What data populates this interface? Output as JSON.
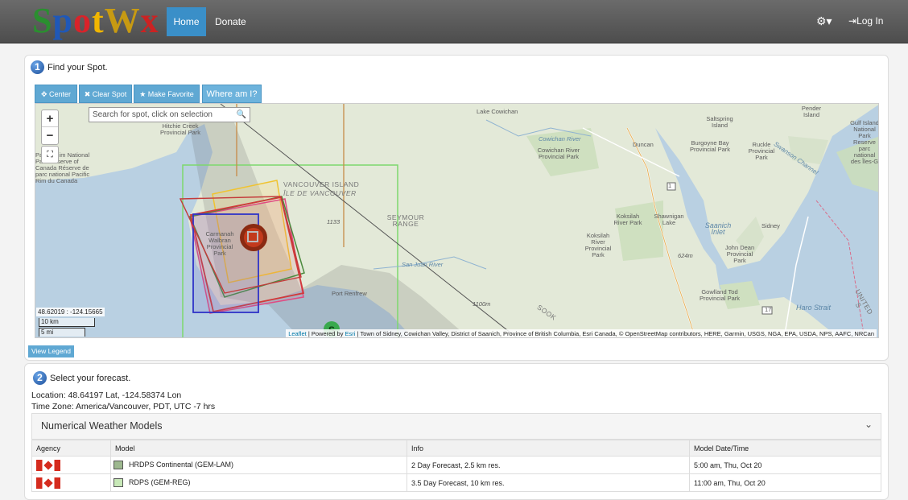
{
  "navbar": {
    "logo": [
      "S",
      "p",
      "o",
      "t",
      "W",
      "x"
    ],
    "home_label": "Home",
    "donate_label": "Donate",
    "settings_icon": "⚙▾",
    "login_label": "Log In"
  },
  "step1": {
    "number": "1",
    "title": "Find your Spot."
  },
  "toolbar": {
    "center_label": "✥ Center",
    "clear_label": "✖ Clear Spot",
    "favorite_label": "★ Make Favorite",
    "where_label": "Where am I?"
  },
  "map": {
    "search_placeholder": "Search for spot, click on selection",
    "zoom_in": "+",
    "zoom_out": "−",
    "coords": "48.62019 : -124.15665",
    "scale_km": "10 km",
    "scale_mi": "5 mi",
    "attribution_leaflet": "Leaflet",
    "attribution_text1": " | Powered by ",
    "attribution_esri": "Esri",
    "attribution_text2": " | Town of Sidney, Cowichan Valley, District of Saanich, Province of British Columbia, Esri Canada, © OpenStreetMap contributors, HERE, Garmin, USGS, NGA, EPA, USDA, NPS, AAFC, NRCan",
    "labels": {
      "pender": "Pender Island",
      "saltspring": "Saltspring Island",
      "gulf": "Gulf Island National Park Reserve parc national des Îles-G",
      "lake_cowichan": "Lake Cowichan",
      "duncan": "Duncan",
      "burgoyne": "Burgoyne Bay Provincial Park",
      "ruckle": "Ruckle Provincial Park",
      "hitchie": "Hitchie Creek Provincial Park",
      "pacific_rim": "Pacific Rim National Park Reserve of Canada Réserve de parc national Pacific Rim du Canada",
      "cowichan_river_park": "Cowichan River Provincial Park",
      "vancouver_island": "VANCOUVER ISLAND",
      "ile_vancouver": "ÎLE DE VANCOUVER",
      "seymour": "SEYMOUR RANGE",
      "carmanah": "Carmanah Walbran Provincial Park",
      "koksilah": "Koksilah River Park",
      "koksilah_park": "Koksilah River Provincial Park",
      "shawnigan": "Shawnigan Lake",
      "saanich": "Saanich Inlet",
      "sidney": "Sidney",
      "john_dean": "John Dean Provincial Park",
      "gowlland": "Gowlland Tod Provincial Park",
      "haro": "Haro Strait",
      "port_renfrew": "Port Renfrew",
      "san_juan": "San Juan River",
      "cowichan_river": "Cowichan River",
      "elev_624": "624m",
      "elev_1100": "1100m",
      "elev_1133": "1133",
      "sooke": "SOOK",
      "us": "UNITED S",
      "hw1": "1",
      "hw17": "17",
      "channel": "Swanson Channel"
    }
  },
  "legend_button": "View Legend",
  "step2": {
    "number": "2",
    "title": "Select your forecast.",
    "location": "Location: 48.64197 Lat, -124.58374 Lon",
    "timezone": "Time Zone: America/Vancouver, PDT, UTC -7 hrs"
  },
  "models_section": {
    "title": "Numerical Weather Models",
    "chevron": "⌄",
    "columns": [
      "Agency",
      "Model",
      "Info",
      "Model Date/Time"
    ],
    "rows": [
      {
        "model": "HRDPS Continental (GEM-LAM)",
        "info": "2 Day Forecast, 2.5 km res.",
        "datetime": "5:00 am, Thu, Oct 20",
        "swatch": "#9db88f"
      },
      {
        "model": "RDPS (GEM-REG)",
        "info": "3.5 Day Forecast, 10 km res.",
        "datetime": "11:00 am, Thu, Oct 20",
        "swatch": "#c7e8b7"
      }
    ]
  }
}
